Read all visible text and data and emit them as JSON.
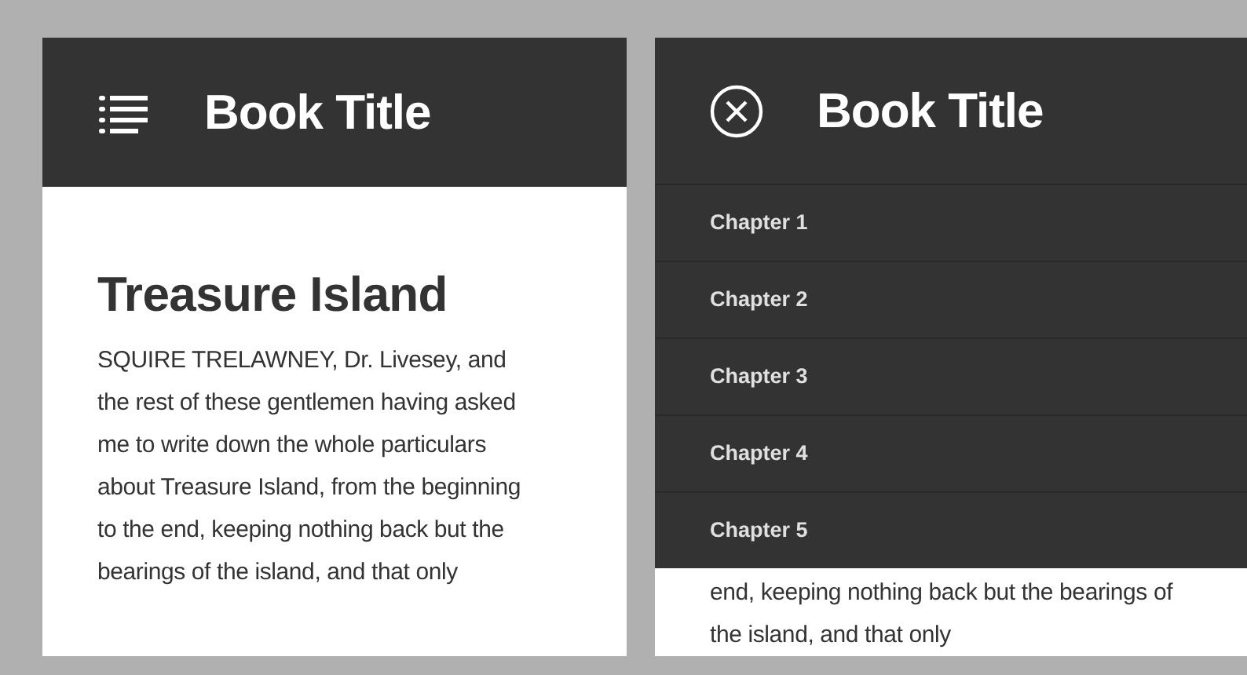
{
  "screens": [
    {
      "kind": "reading",
      "header": {
        "title": "Book Title"
      },
      "heading": "Treasure Island",
      "paragraph": "SQUIRE TRELAWNEY, Dr. Livesey, and the rest of these gentlemen having asked me to write down the whole particulars about Treasure Island, from the beginning to the end, keeping nothing back but the bearings of the island, and that only"
    },
    {
      "kind": "menu-open",
      "header": {
        "title": "Book Title"
      },
      "menu": [
        "Chapter 1",
        "Chapter 2",
        "Chapter 3",
        "Chapter 4",
        "Chapter 5"
      ],
      "paragraph": "end, keeping nothing back but the bearings of the island, and that only"
    }
  ]
}
